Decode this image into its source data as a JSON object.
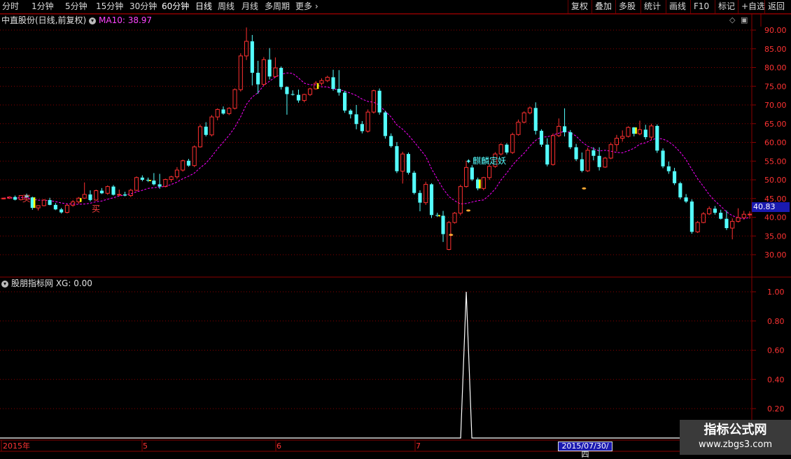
{
  "toolbar": {
    "left": [
      "分时",
      "1分钟",
      "5分钟",
      "15分钟",
      "30分钟",
      "60分钟",
      "日线",
      "周线",
      "月线",
      "多周期",
      "更多"
    ],
    "active": "日线",
    "right": [
      "复权",
      "叠加",
      "多股",
      "统计",
      "画线",
      "F10",
      "标记",
      "+自选",
      "返回"
    ]
  },
  "header": {
    "stock_name": "中直股份(日线,前复权)",
    "ma_label": "MA10: 38.97"
  },
  "indicator": {
    "title": "股朋指标网 XG: 0.00"
  },
  "price_axis": [
    "90.00",
    "85.00",
    "80.00",
    "75.00",
    "70.00",
    "65.00",
    "60.00",
    "55.00",
    "50.00",
    "45.00",
    "40.00",
    "35.00",
    "30.00"
  ],
  "indicator_axis": [
    "1.00",
    "0.80",
    "0.60",
    "0.40",
    "0.20"
  ],
  "current_price": "40.83",
  "x_axis": [
    "2015年",
    "5",
    "6",
    "7"
  ],
  "selected_date": "2015/07/30/四",
  "annotations": {
    "buy1": "买",
    "buy2": "买",
    "signal": "麒麟定妖"
  },
  "watermark": {
    "line1": "指标公式网",
    "line2": "www.zbgs3.com"
  },
  "colors": {
    "up": "#ff3030",
    "down": "#54ffff",
    "doji": "#ffff00",
    "ma": "#ff00ff",
    "axis_text": "#ff3333",
    "frame": "#8b0000",
    "grid": "#8b0000"
  },
  "chart_data": {
    "type": "candlestick",
    "ma_period": 10,
    "ylim": [
      28,
      92
    ],
    "candles": [
      [
        45.0,
        45.2,
        44.8,
        45.1
      ],
      [
        45.1,
        45.6,
        44.9,
        45.4
      ],
      [
        45.4,
        45.8,
        44.5,
        44.7
      ],
      [
        44.7,
        45.9,
        44.5,
        45.8
      ],
      [
        45.8,
        46.3,
        45.1,
        45.3
      ],
      [
        45.3,
        45.5,
        42.0,
        42.5
      ],
      [
        42.5,
        43.2,
        41.8,
        43.1
      ],
      [
        43.1,
        44.8,
        42.9,
        44.6
      ],
      [
        44.6,
        45.2,
        43.2,
        43.3
      ],
      [
        43.3,
        43.8,
        41.9,
        42.1
      ],
      [
        42.1,
        42.5,
        41.0,
        41.3
      ],
      [
        41.3,
        43.5,
        41.0,
        43.2
      ],
      [
        43.2,
        44.6,
        42.8,
        44.1
      ],
      [
        44.1,
        45.4,
        43.6,
        45.1
      ],
      [
        45.1,
        49.3,
        44.9,
        46.1
      ],
      [
        46.1,
        47.2,
        44.2,
        44.6
      ],
      [
        44.6,
        47.4,
        44.4,
        47.1
      ],
      [
        47.1,
        47.8,
        46.2,
        46.4
      ],
      [
        46.4,
        48.5,
        46.0,
        48.2
      ],
      [
        48.2,
        48.6,
        45.8,
        46.0
      ],
      [
        46.0,
        47.4,
        45.6,
        46.1
      ],
      [
        46.1,
        46.8,
        45.6,
        45.8
      ],
      [
        45.8,
        47.6,
        45.4,
        47.2
      ],
      [
        47.2,
        50.9,
        47.0,
        50.6
      ],
      [
        50.6,
        51.2,
        49.6,
        50.0
      ],
      [
        50.0,
        50.6,
        49.4,
        49.8
      ],
      [
        49.8,
        51.8,
        48.5,
        48.8
      ],
      [
        48.8,
        51.6,
        47.6,
        48.2
      ],
      [
        48.2,
        50.3,
        48.0,
        50.1
      ],
      [
        50.1,
        51.1,
        49.4,
        50.8
      ],
      [
        50.8,
        53.4,
        50.3,
        52.6
      ],
      [
        52.6,
        55.4,
        52.2,
        55.1
      ],
      [
        55.1,
        55.6,
        53.5,
        53.8
      ],
      [
        53.8,
        59.2,
        53.4,
        58.8
      ],
      [
        58.8,
        64.8,
        58.6,
        64.2
      ],
      [
        64.2,
        65.4,
        61.6,
        62.0
      ],
      [
        62.0,
        67.3,
        61.6,
        66.8
      ],
      [
        66.8,
        69.1,
        65.9,
        68.8
      ],
      [
        68.8,
        69.6,
        67.4,
        67.7
      ],
      [
        67.7,
        69.4,
        67.3,
        69.1
      ],
      [
        69.1,
        74.4,
        68.8,
        74.1
      ],
      [
        74.1,
        83.8,
        73.6,
        83.1
      ],
      [
        83.1,
        90.7,
        82.0,
        87.0
      ],
      [
        87.0,
        88.7,
        75.2,
        78.6
      ],
      [
        78.6,
        81.8,
        73.0,
        75.5
      ],
      [
        75.5,
        82.8,
        75.1,
        82.1
      ],
      [
        82.1,
        85.2,
        76.8,
        77.6
      ],
      [
        77.6,
        82.7,
        77.3,
        79.9
      ],
      [
        79.9,
        80.3,
        74.1,
        74.8
      ],
      [
        74.8,
        75.0,
        67.4,
        72.9
      ],
      [
        72.9,
        73.9,
        72.5,
        72.7
      ],
      [
        72.7,
        74.1,
        70.6,
        71.2
      ],
      [
        71.2,
        73.0,
        70.7,
        72.8
      ],
      [
        72.8,
        74.6,
        72.4,
        74.3
      ],
      [
        74.3,
        76.4,
        74.1,
        75.8
      ],
      [
        75.8,
        77.1,
        75.2,
        76.5
      ],
      [
        76.5,
        77.8,
        76.1,
        77.4
      ],
      [
        77.4,
        79.4,
        73.8,
        74.3
      ],
      [
        74.3,
        79.3,
        72.5,
        73.3
      ],
      [
        73.3,
        73.8,
        67.9,
        68.5
      ],
      [
        68.5,
        68.9,
        66.4,
        67.5
      ],
      [
        67.5,
        70.0,
        63.5,
        64.9
      ],
      [
        64.9,
        65.7,
        62.4,
        63.0
      ],
      [
        63.0,
        68.8,
        62.6,
        68.1
      ],
      [
        68.1,
        74.1,
        67.7,
        73.8
      ],
      [
        73.8,
        74.4,
        67.4,
        68.0
      ],
      [
        68.0,
        68.4,
        61.0,
        61.7
      ],
      [
        61.7,
        62.4,
        58.6,
        59.0
      ],
      [
        59.0,
        60.1,
        51.8,
        52.3
      ],
      [
        52.3,
        57.5,
        49.0,
        56.9
      ],
      [
        56.9,
        57.3,
        51.4,
        51.9
      ],
      [
        51.9,
        52.4,
        46.1,
        46.5
      ],
      [
        46.5,
        47.2,
        41.6,
        43.9
      ],
      [
        43.9,
        49.5,
        43.3,
        48.8
      ],
      [
        48.8,
        49.1,
        39.8,
        40.6
      ],
      [
        40.6,
        41.2,
        40.1,
        40.4
      ],
      [
        40.4,
        41.7,
        33.4,
        35.5
      ],
      [
        31.4,
        39.0,
        31.2,
        38.6
      ],
      [
        38.6,
        41.4,
        38.3,
        41.1
      ],
      [
        41.1,
        48.7,
        40.5,
        48.2
      ],
      [
        48.2,
        55.1,
        47.9,
        53.3
      ],
      [
        53.3,
        53.9,
        49.7,
        50.1
      ],
      [
        50.1,
        50.6,
        47.2,
        47.7
      ],
      [
        47.7,
        50.8,
        47.2,
        50.6
      ],
      [
        50.6,
        54.2,
        50.0,
        53.6
      ],
      [
        53.6,
        57.4,
        53.2,
        56.9
      ],
      [
        56.9,
        59.8,
        56.5,
        59.4
      ],
      [
        59.4,
        59.8,
        56.8,
        57.3
      ],
      [
        57.3,
        62.6,
        56.9,
        62.1
      ],
      [
        62.1,
        66.1,
        61.8,
        65.4
      ],
      [
        65.4,
        68.3,
        65.1,
        67.9
      ],
      [
        67.9,
        69.6,
        67.5,
        69.2
      ],
      [
        69.2,
        70.7,
        62.1,
        63.1
      ],
      [
        63.1,
        63.5,
        58.8,
        59.4
      ],
      [
        59.4,
        61.1,
        53.6,
        54.1
      ],
      [
        54.1,
        62.4,
        53.8,
        61.8
      ],
      [
        61.8,
        66.4,
        61.4,
        64.3
      ],
      [
        64.3,
        69.1,
        61.6,
        62.7
      ],
      [
        62.7,
        63.3,
        58.2,
        58.7
      ],
      [
        58.7,
        59.6,
        55.0,
        55.5
      ],
      [
        55.5,
        57.3,
        52.0,
        52.4
      ],
      [
        52.4,
        58.6,
        52.1,
        57.9
      ],
      [
        57.9,
        58.7,
        55.2,
        56.4
      ],
      [
        56.4,
        58.7,
        52.5,
        53.4
      ],
      [
        53.4,
        56.1,
        53.2,
        55.8
      ],
      [
        55.8,
        59.9,
        55.5,
        59.4
      ],
      [
        59.4,
        62.0,
        57.6,
        61.1
      ],
      [
        61.1,
        63.2,
        60.2,
        61.6
      ],
      [
        61.6,
        64.3,
        61.3,
        64.0
      ],
      [
        64.0,
        64.1,
        61.6,
        62.3
      ],
      [
        62.3,
        65.8,
        61.9,
        63.4
      ],
      [
        63.4,
        64.7,
        60.8,
        61.4
      ],
      [
        61.4,
        65.0,
        60.7,
        64.4
      ],
      [
        64.4,
        64.8,
        57.2,
        57.8
      ],
      [
        57.8,
        58.4,
        53.1,
        53.6
      ],
      [
        53.6,
        54.9,
        51.6,
        52.3
      ],
      [
        52.3,
        53.2,
        48.6,
        49.1
      ],
      [
        49.1,
        49.5,
        44.8,
        45.3
      ],
      [
        45.3,
        46.2,
        43.8,
        44.2
      ],
      [
        44.2,
        44.8,
        35.6,
        36.1
      ],
      [
        36.1,
        39.0,
        35.8,
        38.6
      ],
      [
        38.6,
        41.4,
        38.4,
        40.9
      ],
      [
        40.9,
        42.9,
        40.6,
        42.3
      ],
      [
        42.3,
        43.0,
        40.7,
        41.2
      ],
      [
        41.2,
        42.0,
        39.4,
        39.6
      ],
      [
        39.6,
        41.8,
        36.6,
        37.1
      ],
      [
        37.1,
        39.7,
        34.1,
        38.9
      ],
      [
        38.9,
        42.4,
        38.6,
        39.9
      ],
      [
        39.9,
        41.7,
        39.5,
        40.8
      ],
      [
        40.8,
        41.6,
        39.6,
        40.83
      ]
    ],
    "indicator_xg": {
      "peak_index": 80,
      "peak_value": 1.0,
      "other": 0.0
    }
  }
}
